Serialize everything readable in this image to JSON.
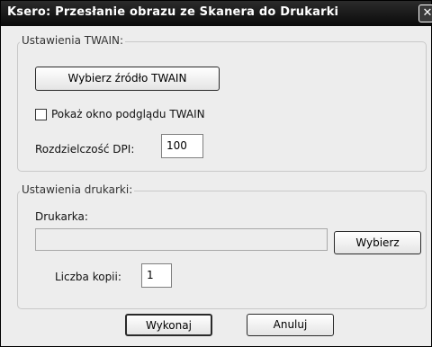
{
  "window": {
    "title": "Ksero: Przesłanie obrazu ze Skanera do Drukarki",
    "close_glyph": "✕"
  },
  "twain": {
    "legend": "Ustawienia TWAIN:",
    "select_source_label": "Wybierz źródło TWAIN",
    "preview_checkbox_label": "Pokaż okno podglądu TWAIN",
    "preview_checked": false,
    "dpi_label": "Rozdzielczość DPI:",
    "dpi_value": "100"
  },
  "printer": {
    "legend": "Ustawienia drukarki:",
    "printer_label": "Drukarka:",
    "printer_value": "",
    "choose_label": "Wybierz",
    "copies_label": "Liczba kopii:",
    "copies_value": "1"
  },
  "actions": {
    "run_label": "Wykonaj",
    "cancel_label": "Anuluj"
  }
}
